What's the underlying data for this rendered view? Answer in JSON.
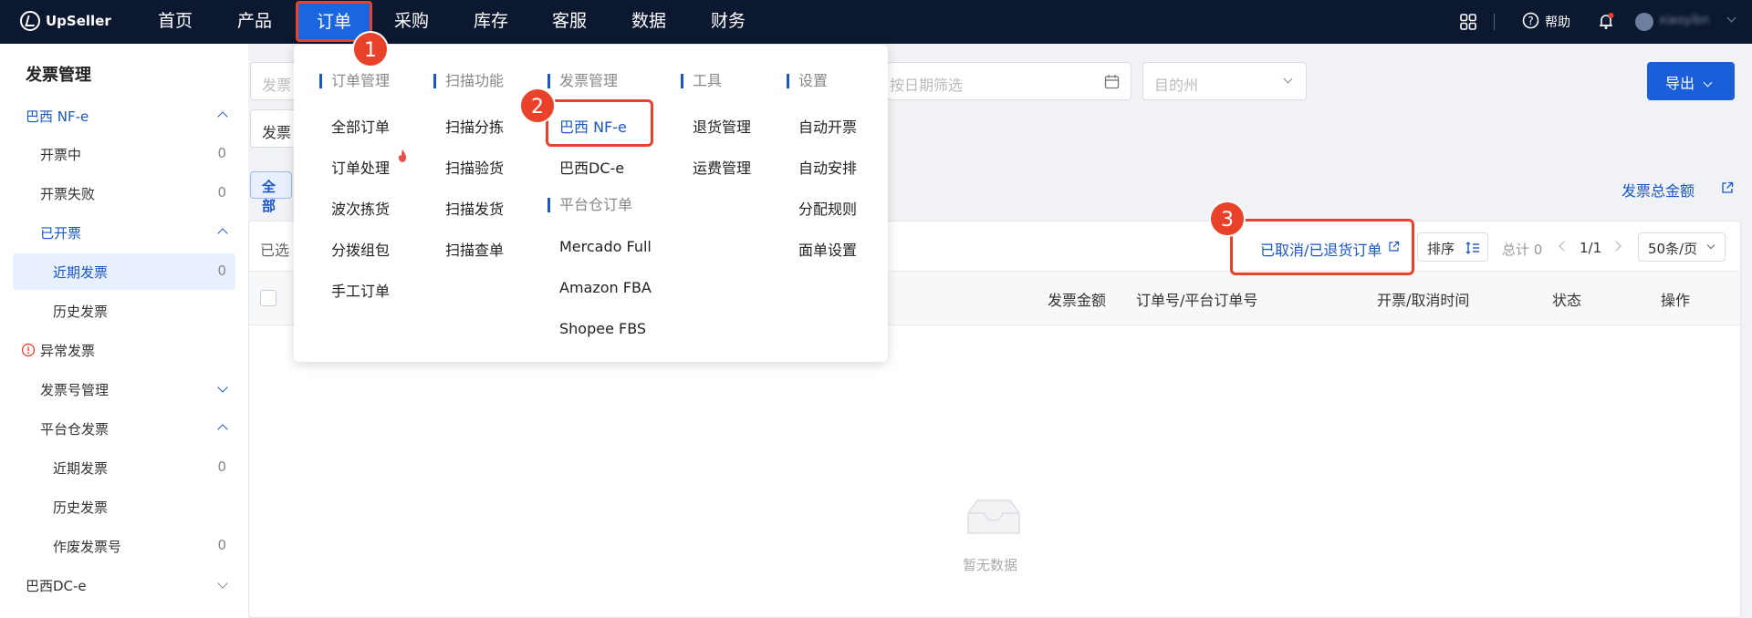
{
  "app": {
    "name": "UpSeller"
  },
  "topnav": {
    "items": [
      {
        "label": "首页"
      },
      {
        "label": "产品"
      },
      {
        "label": "订单"
      },
      {
        "label": "采购"
      },
      {
        "label": "库存"
      },
      {
        "label": "客服"
      },
      {
        "label": "数据"
      },
      {
        "label": "财务"
      }
    ],
    "help_label": "帮助",
    "user_name": "xiaoyibn"
  },
  "sidebar": {
    "title": "发票管理",
    "items": [
      {
        "label": "巴西 NF-e"
      },
      {
        "label": "开票中",
        "count": "0"
      },
      {
        "label": "开票失败",
        "count": "0"
      },
      {
        "label": "已开票"
      },
      {
        "label": "近期发票",
        "count": "0"
      },
      {
        "label": "历史发票"
      },
      {
        "label": "异常发票"
      },
      {
        "label": "发票号管理"
      },
      {
        "label": "平台仓发票"
      },
      {
        "label": "近期发票",
        "count": "0"
      },
      {
        "label": "历史发票"
      },
      {
        "label": "作废发票号",
        "count": "0"
      },
      {
        "label": "巴西DC-e"
      }
    ]
  },
  "filters": {
    "invoice_placeholder": "发票",
    "date_placeholder": "按日期筛选",
    "state_placeholder": "目的州",
    "second_row_label": "发票",
    "tab_all": "全部"
  },
  "export_label": "导出",
  "total_amount_link": "发票总金额",
  "toolbar": {
    "selected_label": "已选",
    "cancelled_link": "已取消/已退货订单",
    "sort_label": "排序",
    "total_label": "总计 0",
    "page_label": "1/1",
    "page_size": "50条/页"
  },
  "table": {
    "headers": [
      "发票金额",
      "订单号/平台订单号",
      "开票/取消时间",
      "状态",
      "操作"
    ],
    "empty_text": "暂无数据"
  },
  "dropdown": {
    "columns": [
      {
        "head": "订单管理",
        "items": [
          "全部订单",
          "订单处理",
          "波次拣货",
          "分拨组包",
          "手工订单"
        ]
      },
      {
        "head": "扫描功能",
        "items": [
          "扫描分拣",
          "扫描验货",
          "扫描发货",
          "扫描查单"
        ]
      },
      {
        "head": "发票管理",
        "items": [
          "巴西 NF-e",
          "巴西DC-e"
        ],
        "head2": "平台仓订单",
        "items2": [
          "Mercado Full",
          "Amazon FBA",
          "Shopee FBS"
        ]
      },
      {
        "head": "工具",
        "items": [
          "退货管理",
          "运费管理"
        ]
      },
      {
        "head": "设置",
        "items": [
          "自动开票",
          "自动安排",
          "分配规则",
          "面单设置"
        ]
      }
    ]
  },
  "annotations": [
    "1",
    "2",
    "3"
  ]
}
